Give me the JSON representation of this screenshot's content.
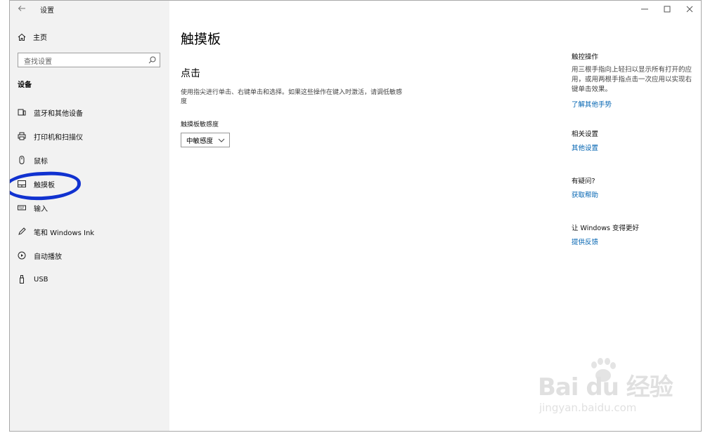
{
  "titlebar": {
    "title": "设置",
    "back_icon": "arrow-left-icon"
  },
  "sidebar": {
    "home_label": "主页",
    "search_placeholder": "查找设置",
    "section_title": "设备",
    "items": [
      {
        "label": "蓝牙和其他设备",
        "icon": "bluetooth-devices-icon"
      },
      {
        "label": "打印机和扫描仪",
        "icon": "printer-icon"
      },
      {
        "label": "鼠标",
        "icon": "mouse-icon"
      },
      {
        "label": "触摸板",
        "icon": "touchpad-icon",
        "selected": true
      },
      {
        "label": "输入",
        "icon": "keyboard-icon"
      },
      {
        "label": "笔和 Windows Ink",
        "icon": "pen-icon"
      },
      {
        "label": "自动播放",
        "icon": "autoplay-icon"
      },
      {
        "label": "USB",
        "icon": "usb-icon"
      }
    ]
  },
  "main": {
    "title": "触摸板",
    "tap_heading": "点击",
    "tap_description": "使用指尖进行单击、右键单击和选择。如果这些操作在键入时激活，请调低敏感度",
    "sensitivity_label": "触摸板敏感度",
    "sensitivity_value": "中敏感度"
  },
  "right_panel": {
    "gestures_title": "触控操作",
    "gestures_text": "用三根手指向上轻扫以显示所有打开的应用，或用两根手指点击一次应用以实现右键单击效果。",
    "gestures_link": "了解其他手势",
    "related_title": "相关设置",
    "related_link": "其他设置",
    "question_title": "有疑问?",
    "question_link": "获取帮助",
    "feedback_title": "让 Windows 变得更好",
    "feedback_link": "提供反馈"
  },
  "watermark": {
    "brand": "Bai du 经验",
    "url": "jingyan.baidu.com"
  },
  "colors": {
    "accent": "#0063b1",
    "sidebar_bg": "#f2f2f2",
    "annotation": "#1132d0"
  }
}
